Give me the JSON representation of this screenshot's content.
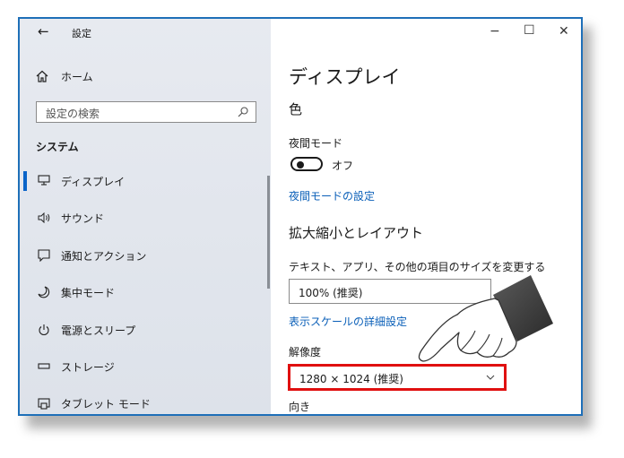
{
  "window": {
    "back_glyph": "←",
    "title": "設定",
    "minimize_glyph": "−",
    "maximize_glyph": "☐",
    "close_glyph": "✕"
  },
  "sidebar": {
    "home": "ホーム",
    "search_placeholder": "設定の検索",
    "section": "システム",
    "items": [
      {
        "label": "ディスプレイ",
        "icon": "monitor-icon"
      },
      {
        "label": "サウンド",
        "icon": "speaker-icon"
      },
      {
        "label": "通知とアクション",
        "icon": "notification-icon"
      },
      {
        "label": "集中モード",
        "icon": "moon-icon"
      },
      {
        "label": "電源とスリープ",
        "icon": "power-icon"
      },
      {
        "label": "ストレージ",
        "icon": "storage-icon"
      },
      {
        "label": "タブレット モード",
        "icon": "tablet-icon"
      }
    ],
    "selected_index": 0
  },
  "main": {
    "page_title": "ディスプレイ",
    "color_heading": "色",
    "night_light_label": "夜間モード",
    "night_light_state": "オフ",
    "night_light_settings_link": "夜間モードの設定",
    "scale_heading": "拡大縮小とレイアウト",
    "scale_label": "テキスト、アプリ、その他の項目のサイズを変更する",
    "scale_value": "100% (推奨)",
    "advanced_scale_link": "表示スケールの詳細設定",
    "resolution_label": "解像度",
    "resolution_value": "1280 × 1024 (推奨)",
    "orientation_label": "向き"
  },
  "colors": {
    "accent": "#0a64c8",
    "highlight_box": "#e01010",
    "window_border": "#1e6fb8"
  }
}
